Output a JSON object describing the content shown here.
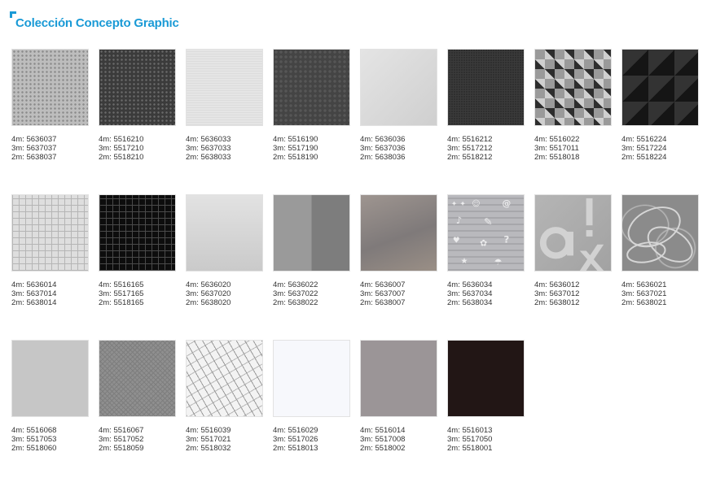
{
  "header": {
    "title": "Colección Concepto Graphic"
  },
  "swatches": [
    {
      "codes": [
        "4m: 5636037",
        "3m: 5637037",
        "2m: 5638037"
      ]
    },
    {
      "codes": [
        "4m: 5516210",
        "3m: 5517210",
        "2m: 5518210"
      ]
    },
    {
      "codes": [
        "4m: 5636033",
        "3m: 5637033",
        "2m: 5638033"
      ]
    },
    {
      "codes": [
        "4m: 5516190",
        "3m: 5517190",
        "2m: 5518190"
      ]
    },
    {
      "codes": [
        "4m: 5636036",
        "3m: 5637036",
        "2m: 5638036"
      ]
    },
    {
      "codes": [
        "4m: 5516212",
        "3m: 5517212",
        "2m: 5518212"
      ]
    },
    {
      "codes": [
        "4m: 5516022",
        "3m: 5517011",
        "2m: 5518018"
      ]
    },
    {
      "codes": [
        "4m: 5516224",
        "3m: 5517224",
        "2m: 5518224"
      ]
    },
    {
      "codes": [
        "4m: 5636014",
        "3m: 5637014",
        "2m: 5638014"
      ]
    },
    {
      "codes": [
        "4m: 5516165",
        "3m: 5517165",
        "2m: 5518165"
      ]
    },
    {
      "codes": [
        "4m: 5636020",
        "3m: 5637020",
        "2m: 5638020"
      ]
    },
    {
      "codes": [
        "4m: 5636022",
        "3m: 5637022",
        "2m: 5638022"
      ]
    },
    {
      "codes": [
        "4m: 5636007",
        "3m: 5637007",
        "2m: 5638007"
      ]
    },
    {
      "codes": [
        "4m: 5636034",
        "3m: 5637034",
        "2m: 5638034"
      ]
    },
    {
      "codes": [
        "4m: 5636012",
        "3m: 5637012",
        "2m: 5638012"
      ]
    },
    {
      "codes": [
        "4m: 5636021",
        "3m: 5637021",
        "2m: 5638021"
      ]
    },
    {
      "codes": [
        "4m: 5516068",
        "3m: 5517053",
        "2m: 5518060"
      ]
    },
    {
      "codes": [
        "4m: 5516067",
        "3m: 5517052",
        "2m: 5518059"
      ]
    },
    {
      "codes": [
        "4m: 5516039",
        "3m: 5517021",
        "2m: 5518032"
      ]
    },
    {
      "codes": [
        "4m: 5516029",
        "3m: 5517026",
        "2m: 5518013"
      ]
    },
    {
      "codes": [
        "4m: 5516014",
        "3m: 5517008",
        "2m: 5518002"
      ]
    },
    {
      "codes": [
        "4m: 5516013",
        "3m: 5517050",
        "2m: 5518001"
      ]
    }
  ],
  "colors": {
    "accent": "#1a9ad6",
    "text": "#333333"
  }
}
